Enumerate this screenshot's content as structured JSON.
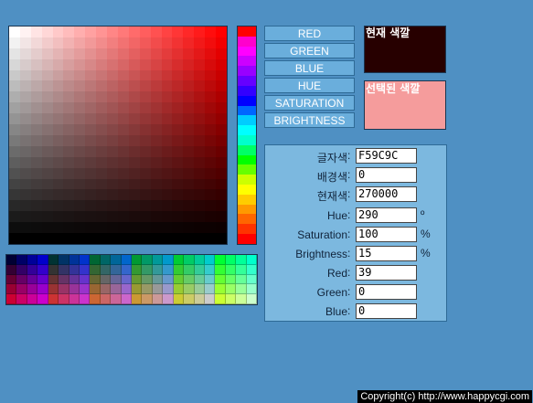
{
  "picker": {
    "base_hue_color": "#ff0000"
  },
  "hue_bar": {
    "colors": [
      "#ff0000",
      "#ff00cc",
      "#ff00ff",
      "#cc00ff",
      "#9900ff",
      "#6600ff",
      "#3300ff",
      "#0000ff",
      "#0066ff",
      "#00ccff",
      "#00ffff",
      "#00ffcc",
      "#00ff66",
      "#00ff00",
      "#66ff00",
      "#ccff00",
      "#ffff00",
      "#ffcc00",
      "#ff9900",
      "#ff6600",
      "#ff3300",
      "#ff0000"
    ]
  },
  "modes": {
    "red": "RED",
    "green": "GREEN",
    "blue": "BLUE",
    "hue": "HUE",
    "saturation": "SATURATION",
    "brightness": "BRIGHTNESS"
  },
  "swatches": {
    "current_label": "현재 색깔",
    "current_color": "#270000",
    "selected_label": "선택된 색깔",
    "selected_color": "#f59c9c"
  },
  "form": {
    "text_color": {
      "label": "글자색",
      "value": "F59C9C"
    },
    "bg_color": {
      "label": "배경색",
      "value": "0"
    },
    "current_color": {
      "label": "현재색",
      "value": "270000"
    },
    "hue": {
      "label": "Hue",
      "value": "290",
      "unit": "º"
    },
    "saturation": {
      "label": "Saturation",
      "value": "100",
      "unit": "%"
    },
    "brightness": {
      "label": "Brightness",
      "value": "15",
      "unit": "%"
    },
    "red": {
      "label": "Red",
      "value": "39"
    },
    "green": {
      "label": "Green",
      "value": "0"
    },
    "blue": {
      "label": "Blue",
      "value": "0"
    },
    "colon": ":"
  },
  "footer": {
    "copyright": "Copyright(c) http://www.happycgi.com"
  }
}
